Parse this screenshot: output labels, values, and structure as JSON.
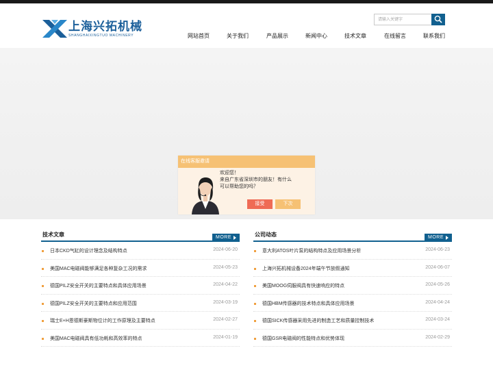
{
  "brand": {
    "name_cn": "上海兴拓机械",
    "name_en": "SHANGHAIXINGTUO MACHINERY",
    "primary_color": "#11608f",
    "accent_color": "#f0a040"
  },
  "search": {
    "placeholder": "请输入关键字",
    "icon": "search-icon"
  },
  "nav": [
    {
      "label": "网站首页"
    },
    {
      "label": "关于我们"
    },
    {
      "label": "产品展示"
    },
    {
      "label": "新闻中心"
    },
    {
      "label": "技术文章"
    },
    {
      "label": "在线留言"
    },
    {
      "label": "联系我们"
    }
  ],
  "chat": {
    "title": "在线客服邀请",
    "lines": [
      "欢迎您！",
      "来自广东省深圳市的朋友！有什么",
      "可以帮助您的吗？"
    ],
    "accept_label": "接受",
    "later_label": "下次"
  },
  "tech_articles": {
    "title": "技术文章",
    "more_label": "MORE",
    "items": [
      {
        "title": "日本CKD气缸的设计理念及结构特点",
        "date": "2024-06-20"
      },
      {
        "title": "美国MAC电磁阀能够满足各种复杂工况的需求",
        "date": "2024-05-23"
      },
      {
        "title": "德国PILZ安全开关的主要特点和具体应用场景",
        "date": "2024-04-22"
      },
      {
        "title": "德国PILZ安全开关的主要特点和应用范围",
        "date": "2024-03-19"
      },
      {
        "title": "瑞士E+H恩德斯豪斯物位计的工作原理及主要特点",
        "date": "2024-02-27"
      },
      {
        "title": "美国MAC电磁阀具有低功耗和高效率的特点",
        "date": "2024-01-19"
      }
    ]
  },
  "company_news": {
    "title": "公司动态",
    "more_label": "MORE",
    "items": [
      {
        "title": "意大利ATOS叶片泵的结构特点及应用场景分析",
        "date": "2024-06-23"
      },
      {
        "title": "上海兴拓机械设备2024年端午节放假通知",
        "date": "2024-06-07"
      },
      {
        "title": "美国MOOG伺服阀具有快速响应的特点",
        "date": "2024-05-26"
      },
      {
        "title": "德国HBM传感器的技术特点和具体应用场景",
        "date": "2024-04-24"
      },
      {
        "title": "德国SICK传感器采用先进的制造工艺和质量控制技术",
        "date": "2024-03-24"
      },
      {
        "title": "德国GSR电磁阀的性能特点和优势体现",
        "date": "2024-02-29"
      }
    ]
  }
}
